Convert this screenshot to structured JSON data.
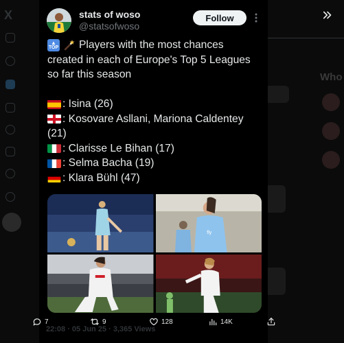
{
  "tweet": {
    "display_name": "stats of woso",
    "handle": "@statsofwoso",
    "follow_label": "Follow",
    "more_label": "∙∙∙",
    "text": {
      "intro_lines": [
        "Players with the most chances",
        "created in each of Europe's Top 5 Leagues",
        "so far this season"
      ],
      "entries": [
        {
          "flag": "spain",
          "lines": [
            ": Isina (26)"
          ]
        },
        {
          "flag": "england",
          "lines": [
            ": Kosovare Asllani, Mariona Caldentey",
            "(21)"
          ]
        },
        {
          "flag": "italy",
          "lines": [
            ": Clarisse Le Bihan (17)"
          ]
        },
        {
          "flag": "france",
          "lines": [
            ": Selma Bacha (19)"
          ]
        },
        {
          "flag": "germany",
          "lines": [
            ": Klara Bühl (47)"
          ]
        }
      ]
    },
    "top_emoji_label": "TOP",
    "actions": {
      "replies": "7",
      "reposts": "9",
      "likes": "128",
      "views": "14K"
    },
    "faint_meta": "22:08 · 05 Jun 25 · 3,365 Views"
  },
  "background": {
    "who_to_follow_label": "Who"
  },
  "icons": [
    "x-logo-icon",
    "close-icon",
    "more-icon",
    "reply-icon",
    "repost-icon",
    "like-icon",
    "views-icon",
    "share-icon"
  ],
  "colors": {
    "background": "#000000",
    "text": "#e7e9ea",
    "muted": "#71767b",
    "follow_bg": "#eff3f4"
  }
}
